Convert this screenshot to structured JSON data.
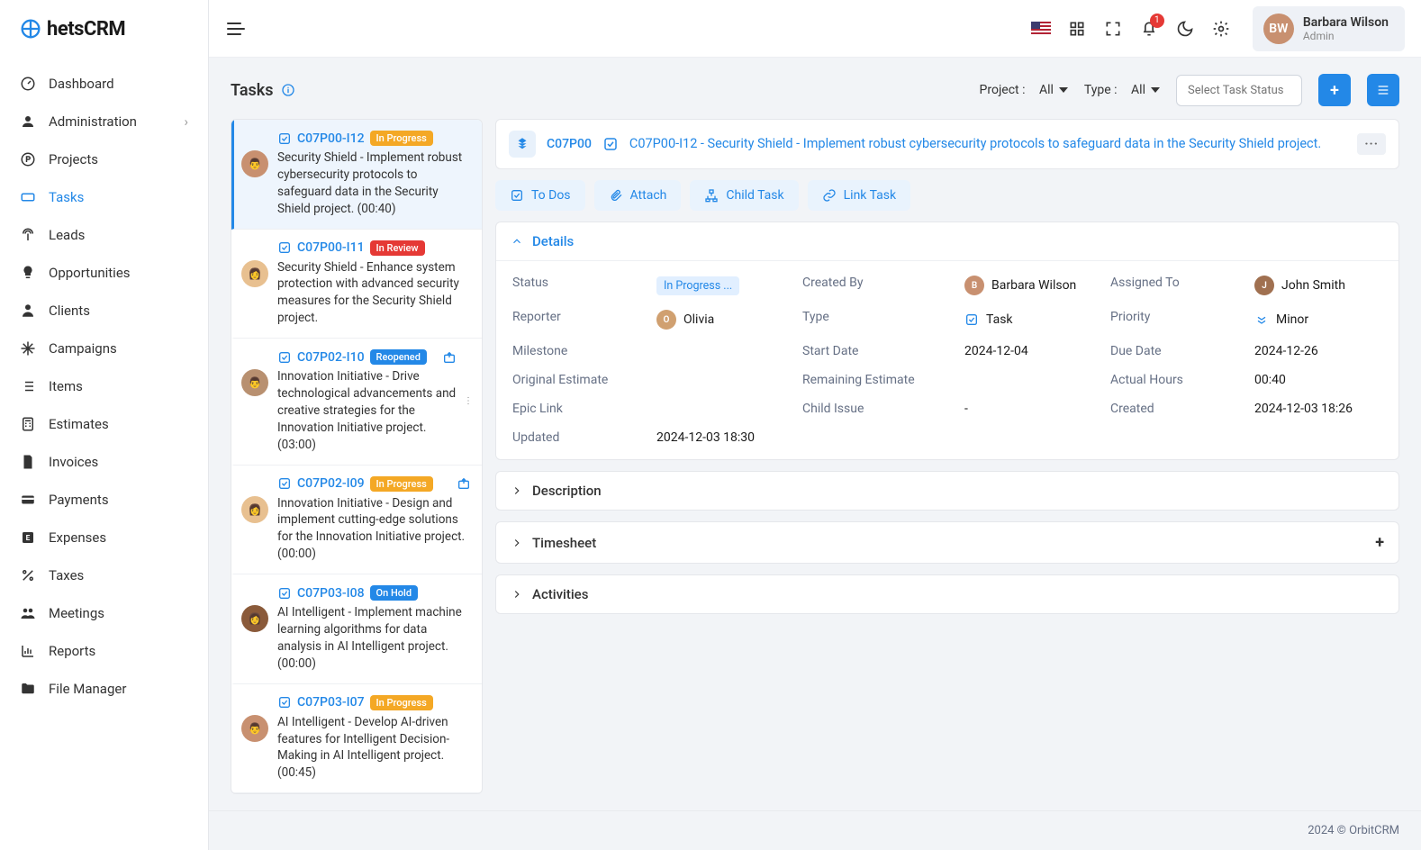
{
  "brand": "hetsCRM",
  "user": {
    "name": "Barbara Wilson",
    "role": "Admin"
  },
  "notification_count": "1",
  "nav": [
    {
      "label": "Dashboard"
    },
    {
      "label": "Administration"
    },
    {
      "label": "Projects"
    },
    {
      "label": "Tasks"
    },
    {
      "label": "Leads"
    },
    {
      "label": "Opportunities"
    },
    {
      "label": "Clients"
    },
    {
      "label": "Campaigns"
    },
    {
      "label": "Items"
    },
    {
      "label": "Estimates"
    },
    {
      "label": "Invoices"
    },
    {
      "label": "Payments"
    },
    {
      "label": "Expenses"
    },
    {
      "label": "Taxes"
    },
    {
      "label": "Meetings"
    },
    {
      "label": "Reports"
    },
    {
      "label": "File Manager"
    }
  ],
  "page_title": "Tasks",
  "filters": {
    "project_label": "Project :",
    "project_value": "All",
    "type_label": "Type :",
    "type_value": "All",
    "status_placeholder": "Select Task Status"
  },
  "tasks": [
    {
      "id": "C07P00-I12",
      "status": "In Progress",
      "status_class": "progress",
      "desc": "Security Shield - Implement robust cybersecurity protocols to safeguard data in the Security Shield project. (00:40)"
    },
    {
      "id": "C07P00-I11",
      "status": "In Review",
      "status_class": "review",
      "desc": "Security Shield - Enhance system protection with advanced security measures for the Security Shield project."
    },
    {
      "id": "C07P02-I10",
      "status": "Reopened",
      "status_class": "reopened",
      "desc": "Innovation Initiative - Drive technological advancements and creative strategies for the Innovation Initiative project. (03:00)"
    },
    {
      "id": "C07P02-I09",
      "status": "In Progress",
      "status_class": "progress",
      "desc": "Innovation Initiative - Design and implement cutting-edge solutions for the Innovation Initiative project. (00:00)"
    },
    {
      "id": "C07P03-I08",
      "status": "On Hold",
      "status_class": "hold",
      "desc": "AI Intelligent - Implement machine learning algorithms for data analysis in AI Intelligent project. (00:00)"
    },
    {
      "id": "C07P03-I07",
      "status": "In Progress",
      "status_class": "progress",
      "desc": "AI Intelligent - Develop AI-driven features for Intelligent Decision-Making in AI Intelligent project. (00:45)"
    }
  ],
  "detail": {
    "project_code": "C07P00",
    "title": "C07P00-I12 - Security Shield - Implement robust cybersecurity protocols to safeguard data in the Security Shield project.",
    "actions": {
      "todos": "To Dos",
      "attach": "Attach",
      "child": "Child Task",
      "link": "Link Task"
    },
    "sections": {
      "details": "Details",
      "description": "Description",
      "timesheet": "Timesheet",
      "activities": "Activities"
    },
    "fields": {
      "status_lbl": "Status",
      "status_val": "In Progress ...",
      "created_by_lbl": "Created By",
      "created_by_val": "Barbara Wilson",
      "assigned_to_lbl": "Assigned To",
      "assigned_to_val": "John Smith",
      "reporter_lbl": "Reporter",
      "reporter_val": "Olivia",
      "type_lbl": "Type",
      "type_val": "Task",
      "priority_lbl": "Priority",
      "priority_val": "Minor",
      "milestone_lbl": "Milestone",
      "milestone_val": "",
      "start_date_lbl": "Start Date",
      "start_date_val": "2024-12-04",
      "due_date_lbl": "Due Date",
      "due_date_val": "2024-12-26",
      "orig_est_lbl": "Original Estimate",
      "orig_est_val": "",
      "rem_est_lbl": "Remaining Estimate",
      "rem_est_val": "",
      "actual_hrs_lbl": "Actual Hours",
      "actual_hrs_val": "00:40",
      "epic_lbl": "Epic Link",
      "epic_val": "",
      "child_issue_lbl": "Child Issue",
      "child_issue_val": "-",
      "created_lbl": "Created",
      "created_val": "2024-12-03 18:26",
      "updated_lbl": "Updated",
      "updated_val": "2024-12-03 18:30"
    }
  },
  "footer": "2024 © OrbitCRM"
}
